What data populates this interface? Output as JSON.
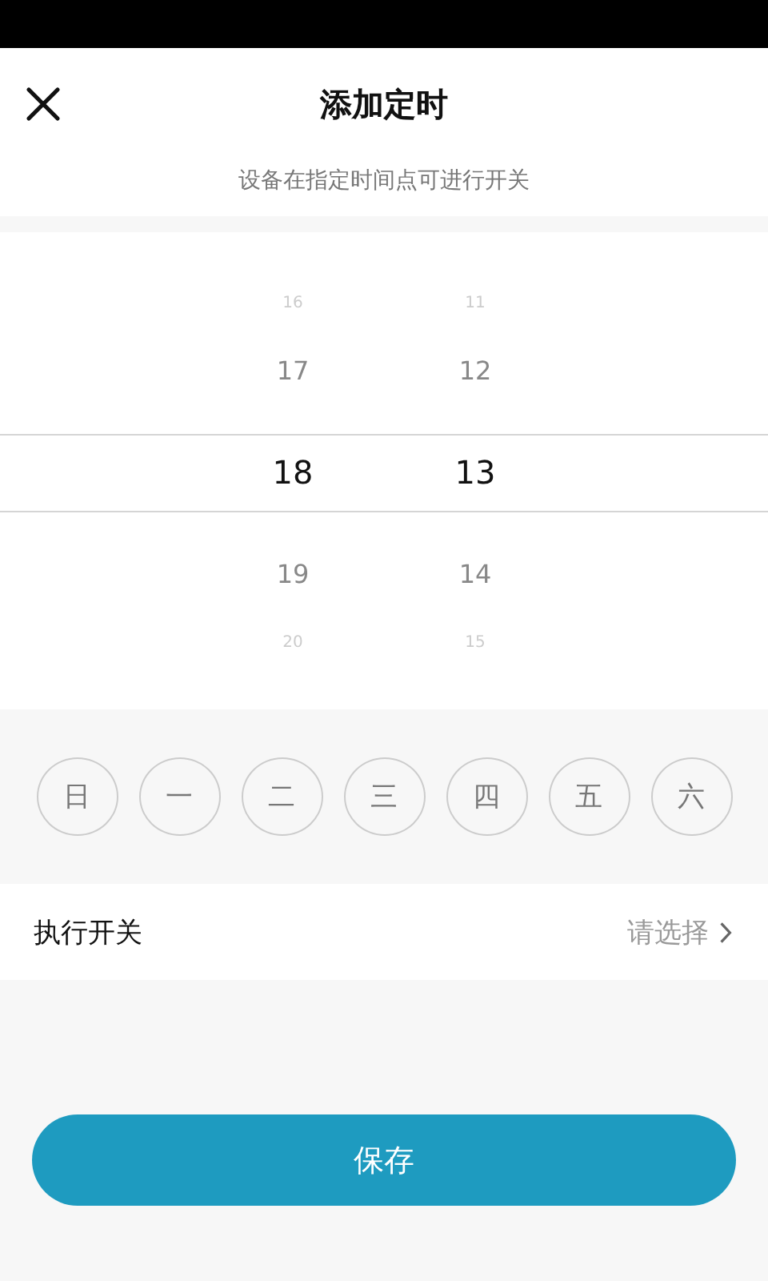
{
  "header": {
    "title": "添加定时",
    "subtitle": "设备在指定时间点可进行开关"
  },
  "picker": {
    "columns": [
      {
        "items": [
          {
            "label": "16",
            "selected": false
          },
          {
            "label": "17",
            "selected": false
          },
          {
            "label": "18",
            "selected": true
          },
          {
            "label": "19",
            "selected": false
          },
          {
            "label": "20",
            "selected": false
          }
        ]
      },
      {
        "items": [
          {
            "label": "11",
            "selected": false
          },
          {
            "label": "12",
            "selected": false
          },
          {
            "label": "13",
            "selected": true
          },
          {
            "label": "14",
            "selected": false
          },
          {
            "label": "15",
            "selected": false
          }
        ]
      }
    ]
  },
  "weekdays": [
    {
      "label": "日",
      "selected": false
    },
    {
      "label": "一",
      "selected": false
    },
    {
      "label": "二",
      "selected": false
    },
    {
      "label": "三",
      "selected": false
    },
    {
      "label": "四",
      "selected": false
    },
    {
      "label": "五",
      "selected": false
    },
    {
      "label": "六",
      "selected": false
    }
  ],
  "switch_row": {
    "label": "执行开关",
    "value": "请选择"
  },
  "save_button": "保存"
}
